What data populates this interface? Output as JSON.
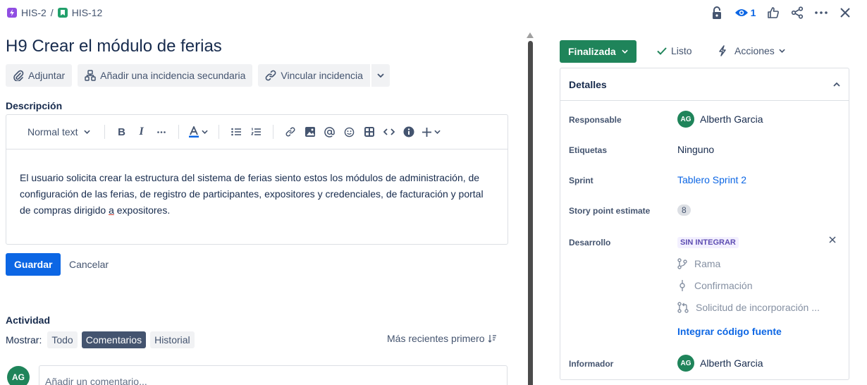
{
  "breadcrumb": {
    "parent": "HIS-2",
    "separator": "/",
    "current": "HIS-12",
    "parent_color": "#904ee2",
    "current_color": "#22a06b"
  },
  "top_actions": {
    "watch_count": "1"
  },
  "issue": {
    "title": "H9 Crear el módulo de ferias"
  },
  "actions": {
    "attach": "Adjuntar",
    "add_child": "Añadir una incidencia secundaria",
    "link_issue": "Vincular incidencia"
  },
  "description": {
    "label": "Descripción",
    "text_style": "Normal text",
    "body_line1": "El usuario solicita crear la estructura del sistema de ferias siento estos los módulos de administración, de",
    "body_line2": "configuración de las ferias, de registro de participantes, expositores y credenciales, de facturación y portal",
    "body_line3_pre": "de compras dirigido ",
    "body_line3_under": "a",
    "body_line3_post": " expositores.",
    "save": "Guardar",
    "cancel": "Cancelar"
  },
  "activity": {
    "label": "Actividad",
    "show": "Mostrar:",
    "filters": [
      "Todo",
      "Comentarios",
      "Historial"
    ],
    "sort": "Más recientes primero",
    "avatar": "AG",
    "comment_placeholder": "Añadir un comentario..."
  },
  "status": {
    "current": "Finalizada",
    "done_label": "Listo",
    "actions_label": "Acciones",
    "status_color": "#1f845a"
  },
  "details": {
    "header": "Detalles",
    "assignee_label": "Responsable",
    "assignee_initials": "AG",
    "assignee": "Alberth Garcia",
    "labels_label": "Etiquetas",
    "labels_value": "Ninguno",
    "sprint_label": "Sprint",
    "sprint_value": "Tablero Sprint 2",
    "story_points_label": "Story point estimate",
    "story_points_value": "8",
    "development_label": "Desarrollo",
    "development_status": "SIN INTEGRAR",
    "branch": "Rama",
    "commit": "Confirmación",
    "pull_request": "Solicitud de incorporación ...",
    "integrate": "Integrar código fuente",
    "reporter_label": "Informador",
    "reporter_initials": "AG",
    "reporter": "Alberth Garcia"
  }
}
